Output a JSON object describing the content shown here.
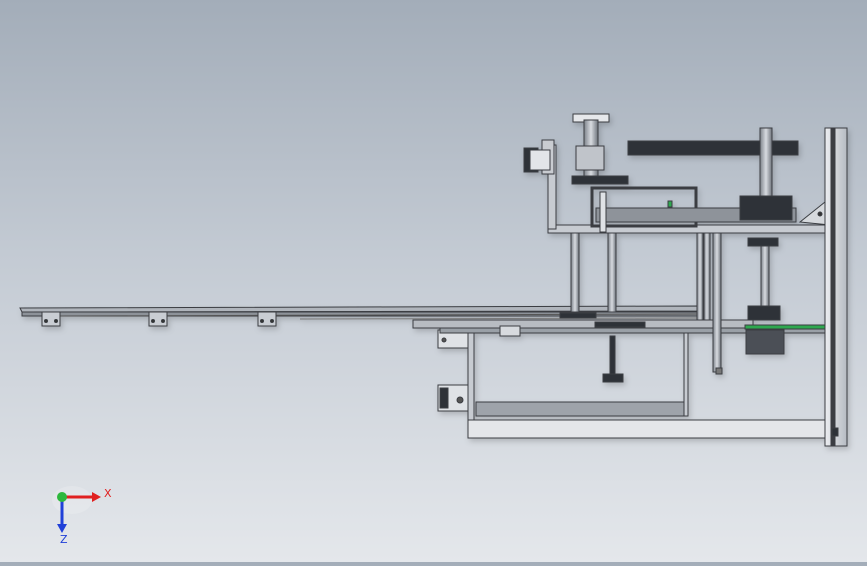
{
  "viewport": {
    "background_top": "#a3adb9",
    "background_bottom": "#e4e7eb"
  },
  "model": {
    "frame_color": "#3a3d42",
    "part_color": "#9ea3aa",
    "dark_part_color": "#2f3237",
    "accent_color": "#2fa84f"
  },
  "triad": {
    "x_label": "X",
    "z_label": "Z",
    "x_color": "#e02020",
    "y_color": "#2db83d",
    "z_color": "#2040d8"
  }
}
